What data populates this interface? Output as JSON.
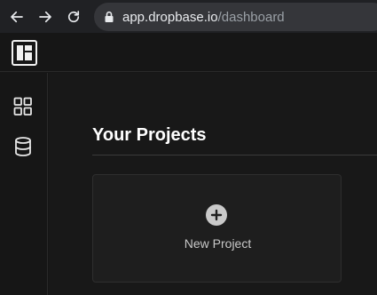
{
  "browser": {
    "url_host": "app.dropbase.io",
    "url_path": "/dashboard",
    "icons": [
      "back-arrow-icon",
      "forward-arrow-icon",
      "reload-icon",
      "lock-icon"
    ]
  },
  "app": {
    "logo_icon": "dropbase-logo-icon",
    "sidebar": [
      {
        "icon": "grid-icon"
      },
      {
        "icon": "database-icon"
      }
    ]
  },
  "main": {
    "page_title": "Your Projects",
    "new_project": {
      "label": "New Project",
      "icon": "plus-circle-icon"
    }
  },
  "colors": {
    "background": "#161616",
    "card": "#1e1e1e",
    "text_primary": "#ffffff",
    "text_secondary": "#c8c8c8"
  }
}
